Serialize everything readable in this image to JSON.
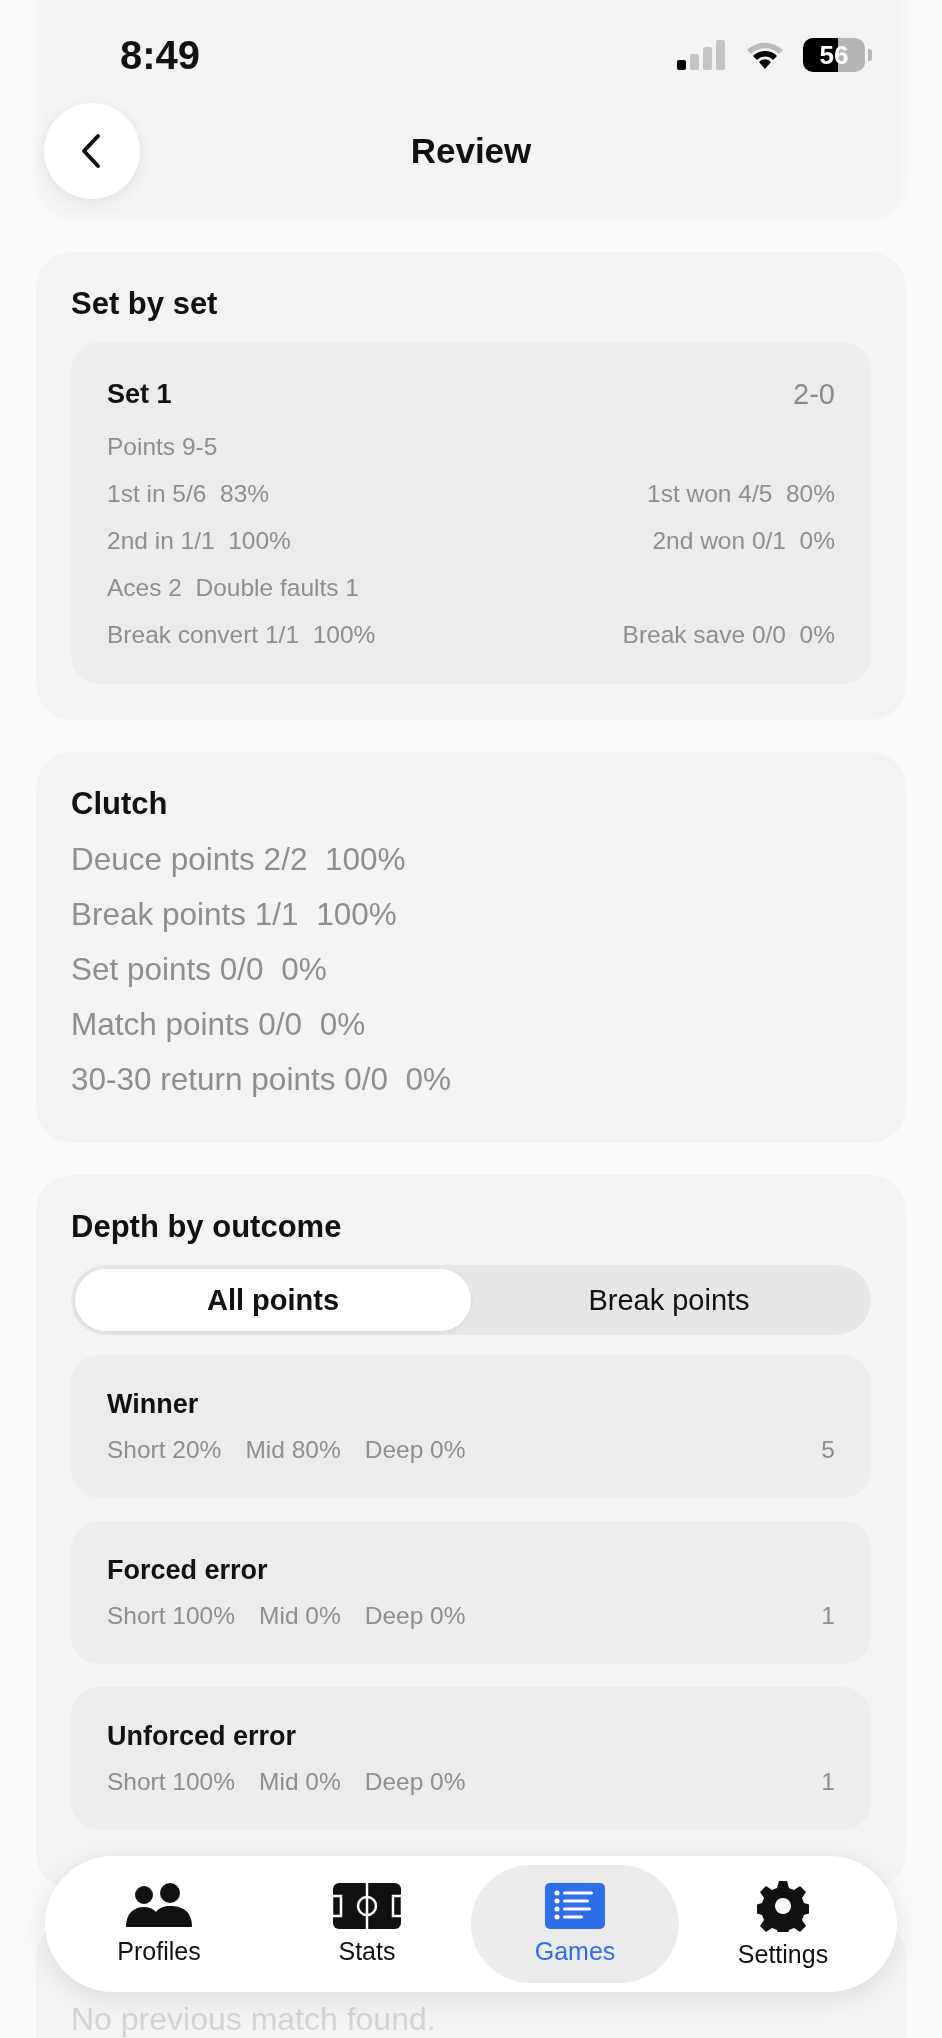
{
  "status_bar": {
    "time": "8:49",
    "battery": "56"
  },
  "header": {
    "title": "Review"
  },
  "set_by_set": {
    "title": "Set by set",
    "sets": [
      {
        "name": "Set 1",
        "score": "2-0",
        "rows": [
          {
            "left": "Points 9-5"
          },
          {
            "left": "1st in 5/6  83%",
            "right": "1st won 4/5  80%"
          },
          {
            "left": "2nd in 1/1  100%",
            "right": "2nd won 0/1  0%"
          },
          {
            "left": "Aces 2  Double faults 1"
          },
          {
            "left": "Break convert 1/1  100%",
            "right": "Break save 0/0  0%"
          }
        ]
      }
    ]
  },
  "clutch": {
    "title": "Clutch",
    "rows": [
      "Deuce points 2/2  100%",
      "Break points 1/1  100%",
      "Set points 0/0  0%",
      "Match points 0/0  0%",
      "30-30 return points 0/0  0%"
    ]
  },
  "depth": {
    "title": "Depth by outcome",
    "segments": [
      {
        "label": "All points",
        "selected": true
      },
      {
        "label": "Break points",
        "selected": false
      }
    ],
    "outcomes": [
      {
        "name": "Winner",
        "short": "Short 20%",
        "mid": "Mid 80%",
        "deep": "Deep 0%",
        "count": "5"
      },
      {
        "name": "Forced error",
        "short": "Short 100%",
        "mid": "Mid 0%",
        "deep": "Deep 0%",
        "count": "1"
      },
      {
        "name": "Unforced error",
        "short": "Short 100%",
        "mid": "Mid 0%",
        "deep": "Deep 0%",
        "count": "1"
      }
    ]
  },
  "comparison": {
    "message": "No previous match found."
  },
  "tab_bar": {
    "tabs": [
      {
        "label": "Profiles",
        "selected": false
      },
      {
        "label": "Stats",
        "selected": false
      },
      {
        "label": "Games",
        "selected": true
      },
      {
        "label": "Settings",
        "selected": false
      }
    ]
  }
}
